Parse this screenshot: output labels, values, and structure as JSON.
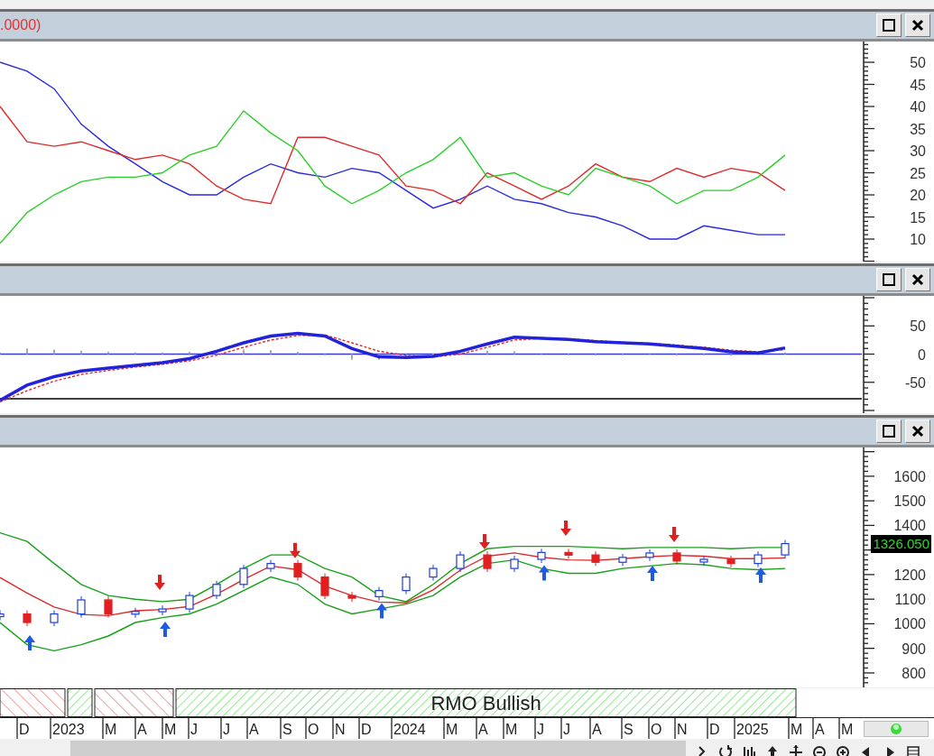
{
  "panels": [
    {
      "header": {
        "text": ".0000)"
      },
      "axis_labels": [
        "50",
        "45",
        "40",
        "35",
        "30",
        "25",
        "20",
        "15",
        "10"
      ]
    },
    {
      "axis_labels": [
        "50",
        "0",
        "-50"
      ]
    },
    {
      "axis_labels": [
        "1600",
        "1500",
        "1400",
        "1200",
        "1100",
        "1000",
        "900",
        "800"
      ],
      "price_tag": {
        "text": "1326.050"
      }
    }
  ],
  "rmo_band": {
    "label": "RMO Bullish",
    "bullish": [
      false,
      false,
      false,
      true,
      false,
      false,
      false,
      true,
      true,
      true,
      true,
      true,
      true,
      true,
      true,
      true,
      true,
      true,
      true,
      true,
      true,
      true,
      true,
      true,
      true,
      true,
      true,
      true,
      true,
      true
    ]
  },
  "time_axis": {
    "labels": [
      "D",
      "2023",
      "M",
      "A",
      "M",
      "J",
      "J",
      "A",
      "S",
      "O",
      "N",
      "D",
      "2024",
      "M",
      "A",
      "M",
      "J",
      "J",
      "A",
      "S",
      "O",
      "N",
      "D",
      "2025",
      "M",
      "A",
      "M"
    ]
  }
}
